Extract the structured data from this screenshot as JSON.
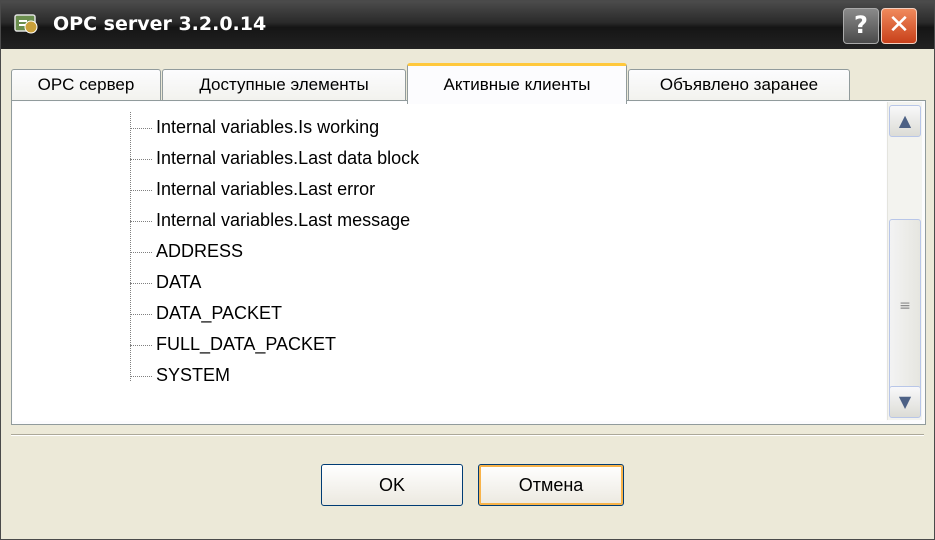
{
  "window": {
    "title": "OPC server 3.2.0.14",
    "help_label": "?",
    "close_label": "✕"
  },
  "tabs": [
    {
      "label": "OPC сервер",
      "active": false
    },
    {
      "label": "Доступные элементы",
      "active": false
    },
    {
      "label": "Активные клиенты",
      "active": true
    },
    {
      "label": "Объявлено заранее",
      "active": false
    }
  ],
  "tree": {
    "items": [
      "Internal variables.Is working",
      "Internal variables.Last data block",
      "Internal variables.Last error",
      "Internal variables.Last message",
      "ADDRESS",
      "DATA",
      "DATA_PACKET",
      "FULL_DATA_PACKET",
      "SYSTEM"
    ]
  },
  "scrollbar": {
    "up_icon": "▲",
    "down_icon": "▼",
    "grip_icon": "≡"
  },
  "buttons": {
    "ok_label": "OK",
    "cancel_label": "Отмена"
  },
  "colors": {
    "title_bg": "#2a2a2a",
    "close_bg": "#d85a2b",
    "active_tab_accent": "#ffc83c"
  }
}
